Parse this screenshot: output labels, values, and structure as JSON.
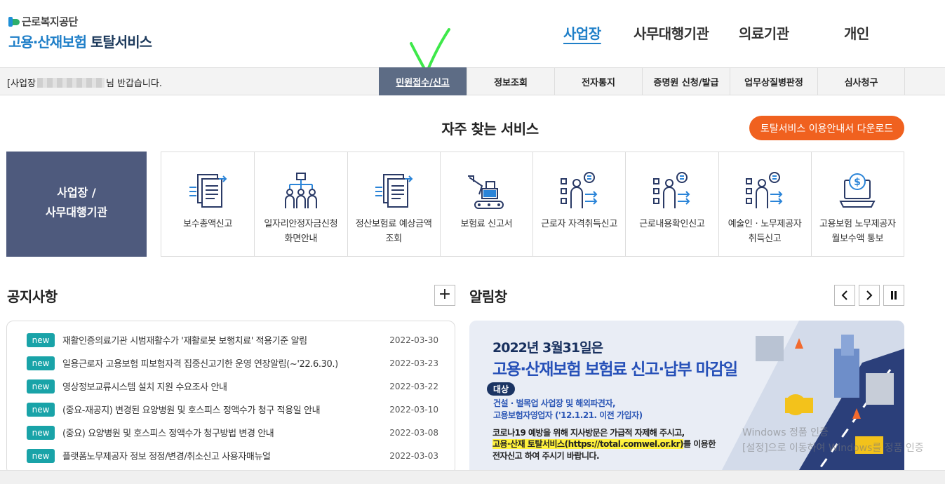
{
  "header": {
    "logo_org": "근로복지공단",
    "logo_title_blue": "고용·산재보험",
    "logo_title_dark": "토탈서비스"
  },
  "gnb": {
    "items": [
      "사업장",
      "사무대행기관",
      "의료기관",
      "개인"
    ],
    "active": "사업장"
  },
  "subnav": {
    "welcome_prefix": "[사업장",
    "welcome_suffix": "님 반갑습니다.",
    "menu": [
      "민원접수/신고",
      "정보조회",
      "전자통지",
      "증명원 신청/발급",
      "업무상질병판정",
      "심사청구"
    ],
    "active": "민원접수/신고"
  },
  "frequent": {
    "title": "자주 찾는 서비스",
    "download_label": "토탈서비스 이용안내서 다운로드",
    "category_line1": "사업장 /",
    "category_line2": "사무대행기관",
    "services": [
      {
        "label": "보수총액신고",
        "icon": "document-arrows-icon"
      },
      {
        "label": "일자리안정자금신청화면안내",
        "icon": "org-chart-people-icon"
      },
      {
        "label": "정산보험료 예상금액 조회",
        "icon": "document-arrows-icon"
      },
      {
        "label": "보험료 신고서",
        "icon": "excavator-icon"
      },
      {
        "label": "근로자 자격취득신고",
        "icon": "person-list-icon"
      },
      {
        "label": "근로내용확인신고",
        "icon": "person-list-icon"
      },
      {
        "label": "예술인 · 노무제공자 취득신고",
        "icon": "person-list-icon"
      },
      {
        "label": "고용보험 노무제공자 월보수액 통보",
        "icon": "money-laptop-icon"
      }
    ]
  },
  "notice": {
    "title": "공지사항",
    "more_label": "+",
    "badge": "new",
    "items": [
      {
        "text": "재활인증의료기관 시범재활수가 '재활로봇 보행치료' 적용기준 알림",
        "date": "2022-03-30"
      },
      {
        "text": "일용근로자 고용보험 피보험자격 집중신고기한 운영 연장알림(~'22.6.30.)",
        "date": "2022-03-23"
      },
      {
        "text": "영상정보교류시스템 설치 지원 수요조사 안내",
        "date": "2022-03-22"
      },
      {
        "text": "(중요-재공지) 변경된 요양병원 및 호스피스 정액수가 청구 적용일 안내",
        "date": "2022-03-10"
      },
      {
        "text": "(중요) 요양병원 및 호스피스 정액수가 청구방법 변경 안내",
        "date": "2022-03-08"
      },
      {
        "text": "플랫폼노무제공자 정보 정정/변경/취소신고 사용자매뉴얼",
        "date": "2022-03-03"
      }
    ]
  },
  "alarm": {
    "title": "알림창",
    "prev_label": "<",
    "next_label": ">",
    "pause_label": "II",
    "banner": {
      "line1": "2022년 3월31일은",
      "line2": "고용·산재보험 보험료 신고·납부 마감일",
      "target_label": "대상",
      "target1": "건설 · 벌목업 사업장 및 해외파견자,",
      "target2": "고용보험자영업자 ('12.1.21. 이전 가입자)",
      "para1": "코로나19 예방을 위해 지사방문은 가급적 자제해 주시고,",
      "para2_highlight": "고용·산재 토탈서비스(https://total.comwel.or.kr)",
      "para2_rest": "를 이용한",
      "para3": "전자신고 하여 주시기 바랍니다."
    }
  },
  "watermark": {
    "line1": "Windows 정품 인증",
    "line2": "[설정]으로 이동하여 Windows를 정품 인증"
  },
  "colors": {
    "brand_blue": "#1f7fc8",
    "menu_active": "#5d6c85",
    "category_bg": "#4e5a7d",
    "download_btn": "#f0611f",
    "new_badge": "#19a3a8",
    "check_mark": "#3ee84a"
  }
}
